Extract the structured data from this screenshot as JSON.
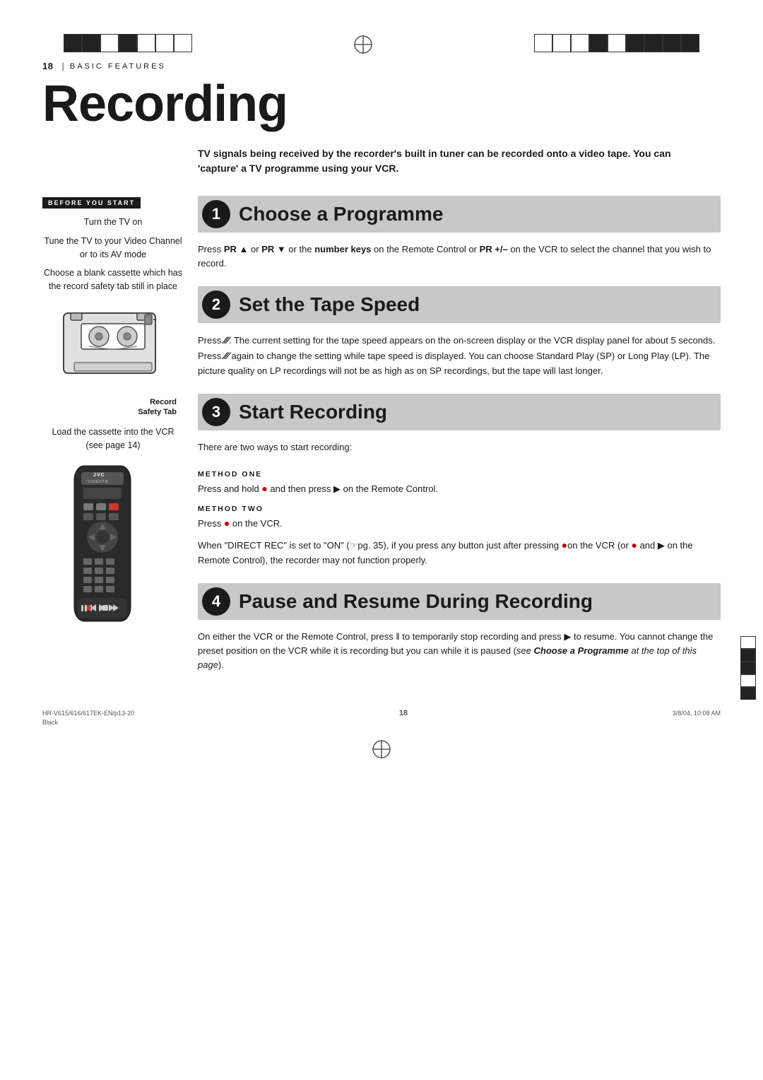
{
  "page": {
    "number": "18",
    "section_label": "BASIC FEATURES",
    "title": "Recording",
    "intro_text": "TV signals being received by the recorder's built in tuner can be recorded onto a video tape. You can 'capture' a TV programme using your VCR.",
    "footer_left": "HR-V615/616/617EK-EN/p13-20",
    "footer_center": "18",
    "footer_right": "3/8/04, 10:08 AM",
    "footer_color": "Black"
  },
  "before_you_start": {
    "label": "BEFORE YOU START",
    "items": [
      "Turn the TV on",
      "Tune the TV to your Video Channel or to its AV mode",
      "Choose a blank cassette which has the record safety tab still in place"
    ]
  },
  "step1": {
    "number": "1",
    "title": "Choose a Programme",
    "content": "Press PR ▲ or PR ▼ or  the number keys on the Remote Control or PR +/– on the VCR to select the channel that you wish to record."
  },
  "step2": {
    "number": "2",
    "title": "Set the Tape Speed",
    "content": "Press ⁄⁄⁄. The current setting for the tape speed appears on the on-screen display or the VCR display panel for about 5 seconds. Press ⁄⁄⁄ again to change the setting while tape speed is displayed. You can choose Standard Play (SP) or Long Play (LP). The picture quality on LP recordings will not be as high as on SP recordings, but the tape will last longer."
  },
  "step3": {
    "number": "3",
    "title": "Start Recording",
    "intro": "There are two ways to start recording:",
    "method_one_label": "METHOD ONE",
    "method_one_text": "Press and hold ● and then press ▶ on the Remote Control.",
    "method_two_label": "METHOD TWO",
    "method_two_text": "Press ● on the VCR.",
    "warning_text": "When \"DIRECT REC\" is set to \"ON\" (☞pg. 35), if you press any button just after pressing ●on the VCR (or ● and ▶ on the Remote Control), the recorder may not function properly."
  },
  "step4": {
    "number": "4",
    "title": "Pause and Resume During Recording",
    "content": "On either the VCR or the Remote Control, press ‖ to temporarily stop recording and press ▶ to resume. You cannot change the preset position on the VCR while it is recording but you can while it is paused (see Choose a Programme at the top of this page)."
  },
  "cassette_label": {
    "record_safety_tab": "Record\nSafety Tab"
  },
  "load_cassette_text": "Load the cassette into the VCR (see page 14)"
}
